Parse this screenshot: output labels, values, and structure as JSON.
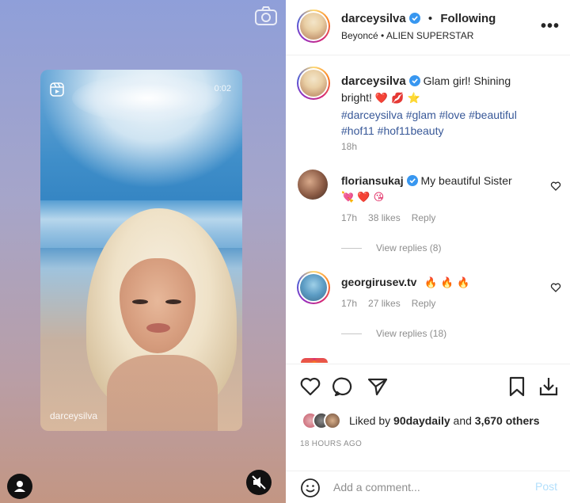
{
  "media": {
    "reel_time": "0:02",
    "reel_username": "darceysilva",
    "camera_icon": "camera-icon",
    "reel_icon": "reels-icon",
    "profile_icon": "user-icon",
    "mute_icon": "muted-speaker-icon"
  },
  "header": {
    "username": "darceysilva",
    "follow_status": "Following",
    "separator": "•",
    "audio": "Beyoncé • ALIEN SUPERSTAR",
    "more_label": "•••"
  },
  "caption": {
    "username": "darceysilva",
    "text": "Glam girl! Shining bright!",
    "emojis": "❤️ 💋 ⭐",
    "hashtags": "#darceysilva #glam #love #beautiful #hof11 #hof11beauty",
    "time": "18h"
  },
  "comments": [
    {
      "username": "floriansukaj",
      "verified": true,
      "text": "My beautiful Sister",
      "emojis": "💘 ❤️ 😘",
      "time": "17h",
      "likes": "38 likes",
      "reply": "Reply",
      "view_replies": "View replies (8)"
    },
    {
      "username": "georgirusev.tv",
      "verified": false,
      "text": "",
      "emojis": "🔥 🔥 🔥",
      "time": "17h",
      "likes": "27 likes",
      "reply": "Reply",
      "view_replies": "View replies (18)"
    }
  ],
  "actions": {
    "like_icon": "heart-icon",
    "comment_icon": "comment-icon",
    "share_icon": "send-icon",
    "save_icon": "bookmark-icon",
    "download_icon": "download-icon"
  },
  "likes": {
    "prefix": "Liked by",
    "user": "90daydaily",
    "middle": "and",
    "count": "3,670 others"
  },
  "post_age": "18 HOURS AGO",
  "comment_box": {
    "placeholder": "Add a comment...",
    "post_label": "Post",
    "emoji_icon": "smiley-icon"
  },
  "colors": {
    "link_blue": "#385898",
    "verified_blue": "#3897f0",
    "muted_text": "#8e8e8e",
    "post_button_disabled": "#b2dffc",
    "heart_red": "#e0245e"
  }
}
